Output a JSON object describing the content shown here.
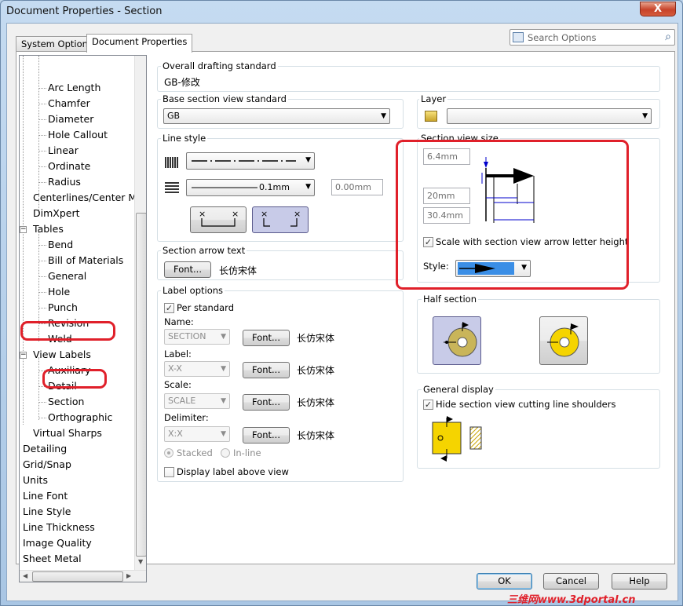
{
  "window": {
    "title": "Document Properties - Section",
    "close_glyph": "X"
  },
  "tabs": [
    "System Options",
    "Document Properties"
  ],
  "search": {
    "placeholder": "Search Options"
  },
  "tree": {
    "items": [
      "Arc Length",
      "Chamfer",
      "Diameter",
      "Hole Callout",
      "Linear",
      "Ordinate",
      "Radius",
      "Centerlines/Center M",
      "DimXpert",
      "Tables",
      "Bend",
      "Bill of Materials",
      "General",
      "Hole",
      "Punch",
      "Revision",
      "Weld",
      "View Labels",
      "Auxiliary",
      "Detail",
      "Section",
      "Orthographic",
      "Virtual Sharps",
      "Detailing",
      "Grid/Snap",
      "Units",
      "Line Font",
      "Line Style",
      "Line Thickness",
      "Image Quality",
      "Sheet Metal"
    ],
    "selected": "Section",
    "expanded_glyph": "−"
  },
  "overall_standard": {
    "label": "Overall drafting standard",
    "value": "GB-修改"
  },
  "base_standard": {
    "label": "Base section view standard",
    "value": "GB"
  },
  "layer": {
    "label": "Layer"
  },
  "line_style": {
    "label": "Line style",
    "thickness": "0.1mm",
    "custom": "0.00mm"
  },
  "section_view_size": {
    "label": "Section view size",
    "v1": "6.4mm",
    "v2": "20mm",
    "v3": "30.4mm",
    "scale_checkbox": "Scale with section view arrow letter height",
    "style_label": "Style:"
  },
  "arrow_text": {
    "label": "Section arrow text",
    "font_button": "Font...",
    "font_name": "长仿宋体"
  },
  "label_options": {
    "label": "Label options",
    "per_standard": "Per standard",
    "name_label": "Name:",
    "name_value": "SECTION",
    "label_label": "Label:",
    "label_value": "X-X",
    "scale_label": "Scale:",
    "scale_value": "SCALE",
    "delim_label": "Delimiter:",
    "delim_value": "X:X",
    "font_button": "Font...",
    "font_name": "长仿宋体",
    "stacked": "Stacked",
    "inline": "In-line",
    "display_above": "Display label above view"
  },
  "half_section": {
    "label": "Half section"
  },
  "general_display": {
    "label": "General display",
    "hide_shoulders": "Hide section view cutting line shoulders"
  },
  "buttons": {
    "ok": "OK",
    "cancel": "Cancel",
    "help": "Help"
  },
  "watermark": "三维网www.3dportal.cn",
  "colors": {
    "accent_red": "#e0202a",
    "selection_blue": "#3399ff",
    "style_blue": "#3a8ee6"
  }
}
